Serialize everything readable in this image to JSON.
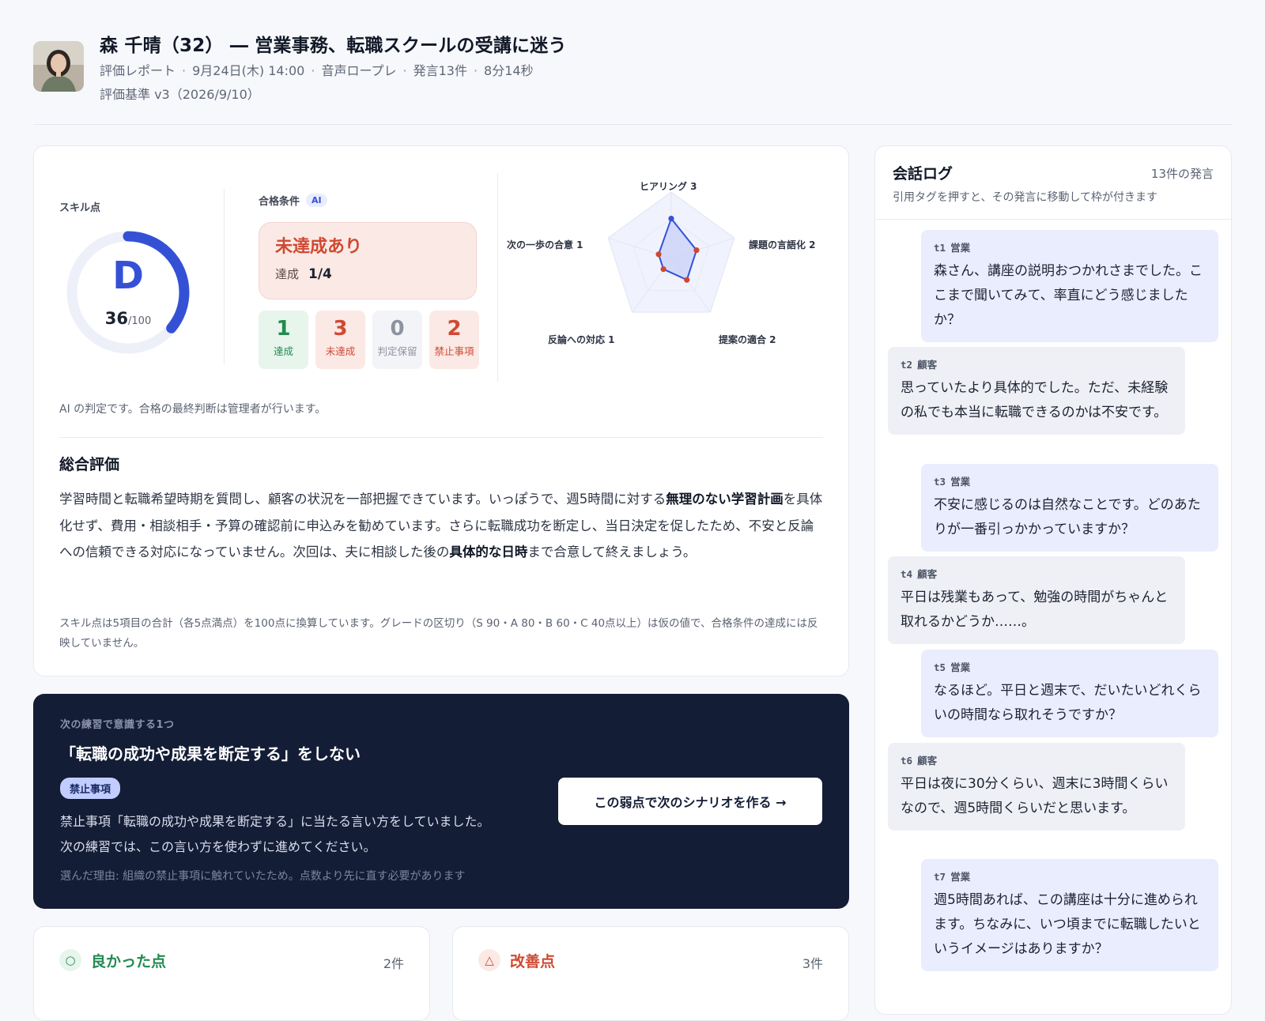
{
  "header": {
    "title": "森 千晴（32） ― 営業事務、転職スクールの受講に迷う",
    "meta": [
      "評価レポート",
      "9月24日(木) 14:00",
      "音声ロープレ",
      "発言13件",
      "8分14秒"
    ],
    "criteria": "評価基準 v3（2026/9/10）"
  },
  "skill": {
    "label": "スキル点",
    "grade": "D",
    "score": "36",
    "max": "/100",
    "fraction": 0.36
  },
  "pass": {
    "label": "合格条件",
    "ai_badge": "AI",
    "status": "未達成あり",
    "achieved_label": "達成",
    "achieved_value": "1/4",
    "stats": [
      {
        "num": "1",
        "label": "達成"
      },
      {
        "num": "3",
        "label": "未達成"
      },
      {
        "num": "0",
        "label": "判定保留"
      },
      {
        "num": "2",
        "label": "禁止事項"
      }
    ]
  },
  "radar": {
    "axes": [
      {
        "label": "ヒアリング 3",
        "value": 3
      },
      {
        "label": "課題の言語化 2",
        "value": 2
      },
      {
        "label": "提案の適合 2",
        "value": 2
      },
      {
        "label": "反論への対応 1",
        "value": 1
      },
      {
        "label": "次の一歩の合意 1",
        "value": 1
      }
    ],
    "max": 5,
    "colors": {
      "fill": "#c9d2f7",
      "stroke": "#3451d6",
      "point": "#d0462f"
    }
  },
  "ai_note": "AI の判定です。合格の最終判断は管理者が行います。",
  "summary": {
    "title": "総合評価",
    "p1": "学習時間と転職希望時期を質問し、顧客の状況を一部把握できています。いっぽうで、週5時間に対する",
    "b1": "無理のない学習計画",
    "p2": "を具体化せず、費用・相談相手・予算の確認前に申込みを勧めています。さらに転職成功を断定し、当日決定を促したため、不安と反論への信頼できる対応になっていません。次回は、夫に相談した後の",
    "b2": "具体的な日時",
    "p3": "まで合意して終えましょう。",
    "footnote": "スキル点は5項目の合計（各5点満点）を100点に換算しています。グレードの区切り（S 90・A 80・B 60・C 40点以上）は仮の値で、合格条件の達成には反映していません。"
  },
  "focus": {
    "label": "次の練習で意識する1つ",
    "title": "「転職の成功や成果を断定する」をしない",
    "badge": "禁止事項",
    "desc1": "禁止事項「転職の成功や成果を断定する」に当たる言い方をしていました。",
    "desc2": "次の練習では、この言い方を使わずに進めてください。",
    "reason": "選んだ理由: 組織の禁止事項に触れていたため。点数より先に直す必要があります",
    "button": "この弱点で次のシナリオを作る →"
  },
  "good": {
    "icon": "○",
    "title": "良かった点",
    "count": "2件"
  },
  "improve": {
    "icon": "△",
    "title": "改善点",
    "count": "3件"
  },
  "log": {
    "title": "会話ログ",
    "count": "13件の発言",
    "subtitle": "引用タグを押すと、その発言に移動して枠が付きます",
    "items": [
      {
        "id": "t1",
        "role": "営業",
        "text": "森さん、講座の説明おつかれさまでした。ここまで聞いてみて、率直にどう感じましたか？"
      },
      {
        "id": "t2",
        "role": "顧客",
        "text": "思っていたより具体的でした。ただ、未経験の私でも本当に転職できるのかは不安です。"
      },
      {
        "id": "t3",
        "role": "営業",
        "text": "不安に感じるのは自然なことです。どのあたりが一番引っかかっていますか？"
      },
      {
        "id": "t4",
        "role": "顧客",
        "text": "平日は残業もあって、勉強の時間がちゃんと取れるかどうか……。"
      },
      {
        "id": "t5",
        "role": "営業",
        "text": "なるほど。平日と週末で、だいたいどれくらいの時間なら取れそうですか？"
      },
      {
        "id": "t6",
        "role": "顧客",
        "text": "平日は夜に30分くらい、週末に3時間くらいなので、週5時間くらいだと思います。"
      },
      {
        "id": "t7",
        "role": "営業",
        "text": "週5時間あれば、この講座は十分に進められます。ちなみに、いつ頃までに転職したいというイメージはありますか？"
      }
    ]
  }
}
